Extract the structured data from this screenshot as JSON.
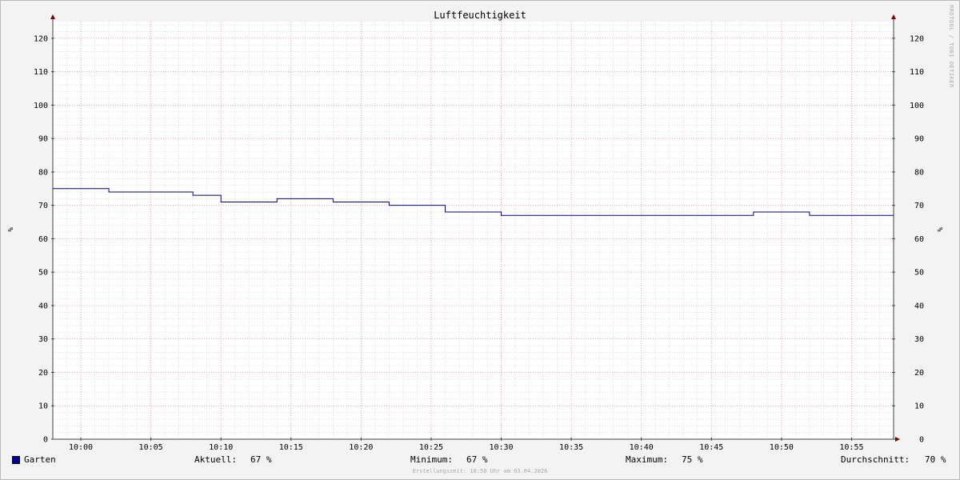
{
  "colors": {
    "background": "#f3f3f3",
    "plot_background": "#ffffff",
    "series": "#000080",
    "legend_swatch": "#0000a0",
    "major_grid": "#e08080",
    "minor_grid": "#c8c8c8",
    "axis": "#404040",
    "arrow": "#800000"
  },
  "watermark": "RRDTOOL / TOBI OETIKER",
  "footer": "Erstellungszeit: 10:58 Uhr am 03.04.2026",
  "legend": {
    "series_name": "Garten",
    "aktuell_label": "Aktuell:",
    "aktuell_value": "67 %",
    "minimum_label": "Minimum:",
    "minimum_value": "67 %",
    "maximum_label": "Maximum:",
    "maximum_value": "75 %",
    "durchschnitt_label": "Durchschnitt:",
    "durchschnitt_value": "70 %"
  },
  "chart_data": {
    "type": "line",
    "title": "Luftfeuchtigkeit",
    "ylabel": "%",
    "ylabel_right": "%",
    "xlim": [
      "09:58",
      "10:58"
    ],
    "ylim": [
      0,
      125
    ],
    "grid": true,
    "x_ticks": [
      "10:00",
      "10:05",
      "10:10",
      "10:15",
      "10:20",
      "10:25",
      "10:30",
      "10:35",
      "10:40",
      "10:45",
      "10:50",
      "10:55"
    ],
    "y_ticks": [
      0,
      10,
      20,
      30,
      40,
      50,
      60,
      70,
      80,
      90,
      100,
      110,
      120
    ],
    "series": [
      {
        "name": "Garten",
        "step": true,
        "points": [
          [
            "09:58",
            75
          ],
          [
            "10:02",
            74
          ],
          [
            "10:08",
            73
          ],
          [
            "10:10",
            71
          ],
          [
            "10:14",
            72
          ],
          [
            "10:18",
            71
          ],
          [
            "10:22",
            70
          ],
          [
            "10:26",
            68
          ],
          [
            "10:28",
            68
          ],
          [
            "10:30",
            67
          ],
          [
            "10:48",
            68
          ],
          [
            "10:52",
            67
          ],
          [
            "10:58",
            67
          ]
        ]
      }
    ]
  }
}
